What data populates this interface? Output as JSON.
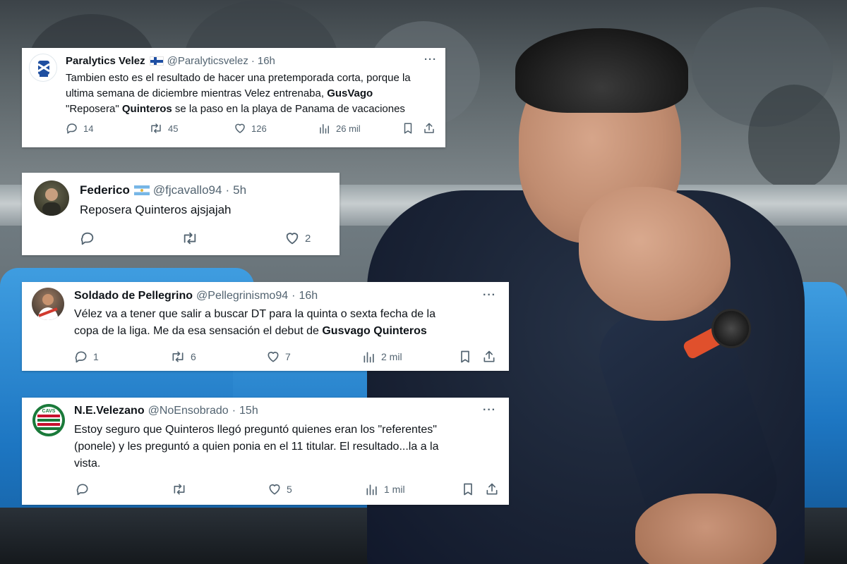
{
  "tweets": [
    {
      "name": "Paralytics Velez",
      "flag": "finland-flag",
      "handle": "@Paralyticsvelez",
      "sep": "·",
      "time": "16h",
      "more": "···",
      "text_parts": [
        "Tambien esto es el resultado de hacer una pretemporada corta, porque la",
        "ultima semana de diciembre mientras Velez entrenaba, ",
        "GusVago",
        "\"Reposera\" ",
        "Quinteros",
        " se la paso en la playa de Panama de vacaciones"
      ],
      "replies": "14",
      "retweets": "45",
      "likes": "126",
      "views": "26 mil"
    },
    {
      "name": "Federico",
      "flag": "argentina-flag",
      "handle": "@fjcavallo94",
      "sep": "·",
      "time": "5h",
      "text": "Reposera Quinteros ajsjajah",
      "replies": "",
      "retweets": "",
      "likes": "2"
    },
    {
      "name": "Soldado de Pellegrino",
      "handle": "@Pellegrinismo94",
      "sep": "·",
      "time": "16h",
      "more": "···",
      "text_parts": [
        "Vélez va a tener que salir a buscar DT para la quinta o sexta fecha de la",
        "copa de la liga. Me da esa sensación el debut de ",
        "Gusvago Quinteros"
      ],
      "replies": "1",
      "retweets": "6",
      "likes": "7",
      "views": "2 mil"
    },
    {
      "name": "N.E.Velezano",
      "handle": "@NoEnsobrado",
      "sep": "·",
      "time": "15h",
      "more": "···",
      "text_lines": [
        "Estoy seguro que Quinteros llegó preguntó quienes eran los \"referentes\"",
        "(ponele) y les preguntó a quien ponia en el 11 titular. El resultado...la a la",
        "vista."
      ],
      "avatar_text": "CAVS",
      "replies": "",
      "retweets": "",
      "likes": "5",
      "views": "1 mil"
    }
  ],
  "colors": {
    "text": "#0f1419",
    "muted": "#536471",
    "seat_blue": "#1d76c2",
    "watch_strap": "#e0502c"
  }
}
